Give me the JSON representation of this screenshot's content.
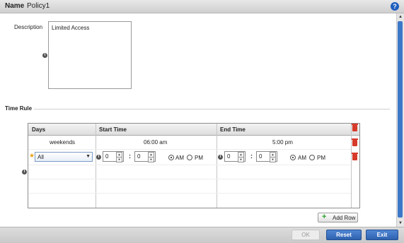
{
  "header": {
    "name_label": "Name",
    "name_value": "Policy1",
    "help_symbol": "?"
  },
  "description": {
    "label": "Description",
    "value": "Limited Access"
  },
  "time_rule": {
    "label": "Time Rule",
    "columns": [
      "Days",
      "Start Time",
      "End Time"
    ],
    "rows": [
      {
        "days": "weekends",
        "start_time": "06:00 am",
        "end_time": "5:00 pm"
      }
    ],
    "edit_row": {
      "days": "All",
      "start_hour": "0",
      "start_minute": "0",
      "end_hour": "0",
      "end_minute": "0",
      "am_label": "AM",
      "pm_label": "PM",
      "start_period": "AM",
      "end_period": "AM",
      "colon": ":"
    },
    "add_row_label": "Add Row"
  },
  "footer": {
    "ok_label": "OK",
    "reset_label": "Reset",
    "exit_label": "Exit"
  },
  "icons": {
    "info": "info-icon",
    "trash": "trash-icon",
    "help": "help-icon",
    "plus": "plus-icon"
  },
  "colors": {
    "accent": "#2e62b0",
    "delete": "#d63a2a",
    "required_star": "#e8a21a",
    "add": "#2aa02a"
  }
}
